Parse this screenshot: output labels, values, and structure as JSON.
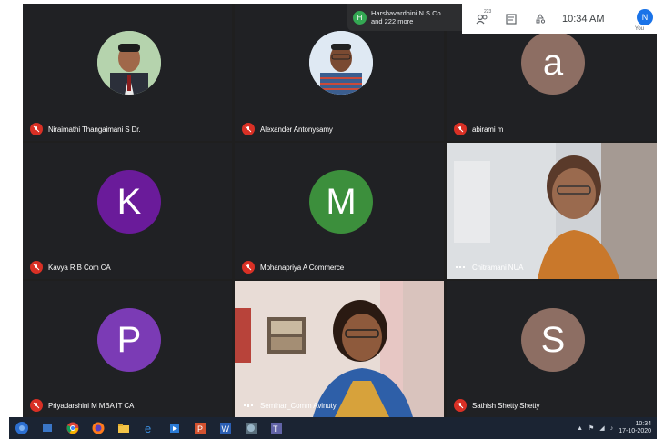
{
  "notification": {
    "initial": "H",
    "line1": "Harshavardhini N S Co...",
    "line2": "and 222 more"
  },
  "topbar": {
    "participants_badge": "223",
    "time": "10:34 AM",
    "self_initial": "N",
    "self_label": "You"
  },
  "participants": [
    {
      "name": "Niraimathi Thangaimani S Dr.",
      "type": "photo"
    },
    {
      "name": "Alexander Antonysamy",
      "type": "photo"
    },
    {
      "name": "abirami m",
      "initial": "a",
      "color": "#8d6e63"
    },
    {
      "name": "Kavya R B Com CA",
      "initial": "K",
      "color": "#6a1b9a"
    },
    {
      "name": "Mohanapriya A Commerce",
      "initial": "M",
      "color": "#3c8f3c"
    },
    {
      "name": "Chitramani NUA",
      "type": "video"
    },
    {
      "name": "Priyadarshini M MBA IT CA",
      "initial": "P",
      "color": "#7b3bb5"
    },
    {
      "name": "Seminar_Comm Avinuty",
      "type": "video"
    },
    {
      "name": "Sathish Shetty Shetty",
      "initial": "S",
      "color": "#8d6e63"
    }
  ],
  "taskbar": {
    "clock_time": "10:34",
    "clock_date": "17-10-2020",
    "apps": [
      "chrome-icon",
      "firefox-icon",
      "file-explorer-icon",
      "edge-icon",
      "store-icon",
      "powerpoint-icon",
      "word-icon",
      "media-icon",
      "teams-icon"
    ]
  }
}
